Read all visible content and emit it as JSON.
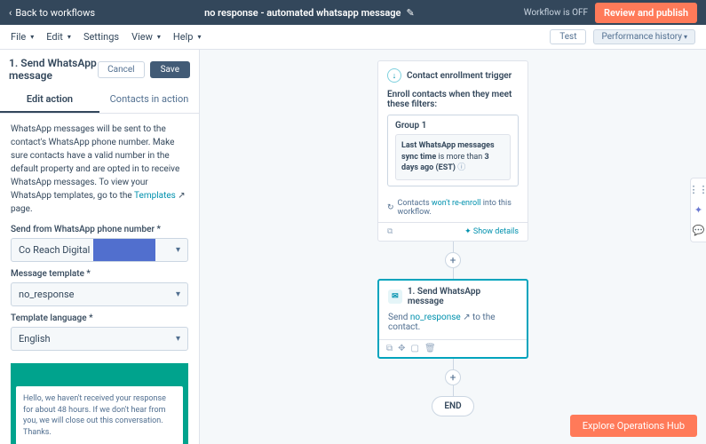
{
  "topbar": {
    "back_label": "Back to workflows",
    "title": "no response - automated whatsapp message",
    "status": "Workflow is OFF",
    "review_label": "Review and publish"
  },
  "menubar": {
    "items": [
      "File",
      "Edit",
      "Settings",
      "View",
      "Help"
    ],
    "test_label": "Test",
    "perf_label": "Performance history"
  },
  "sidebar": {
    "title": "1. Send WhatsApp message",
    "cancel": "Cancel",
    "save": "Save",
    "tabs": {
      "edit": "Edit action",
      "contacts": "Contacts in action"
    },
    "help_text_1": "WhatsApp messages will be sent to the contact's WhatsApp phone number. Make sure contacts have a valid number in the default property and are opted in to receive WhatsApp messages. To view your WhatsApp templates, go to the ",
    "templates_link": "Templates",
    "help_text_2": " page.",
    "field1_label": "Send from WhatsApp phone number *",
    "field1_value": "Co Reach Digital",
    "field2_label": "Message template *",
    "field2_value": "no_response",
    "field3_label": "Template language *",
    "field3_value": "English",
    "preview_msg": "Hello, we haven't received your response for about 48 hours. If we don't hear from you, we will close out this conversation. Thanks."
  },
  "canvas": {
    "trigger": {
      "title": "Contact enrollment trigger",
      "subtitle": "Enroll contacts when they meet these filters:",
      "group_title": "Group 1",
      "filter_prefix": "Last WhatsApp messages sync time",
      "filter_mid": " is more than ",
      "filter_value": "3 days ago (EST)",
      "reenroll_1": "Contacts ",
      "reenroll_link": "won't re-enroll",
      "reenroll_2": " into this workflow.",
      "show_details": "Show details"
    },
    "action": {
      "title": "1. Send WhatsApp message",
      "body_1": "Send ",
      "body_link": "no_response",
      "body_2": " to the contact."
    },
    "end": "END"
  },
  "footer": {
    "explore": "Explore Operations Hub"
  }
}
